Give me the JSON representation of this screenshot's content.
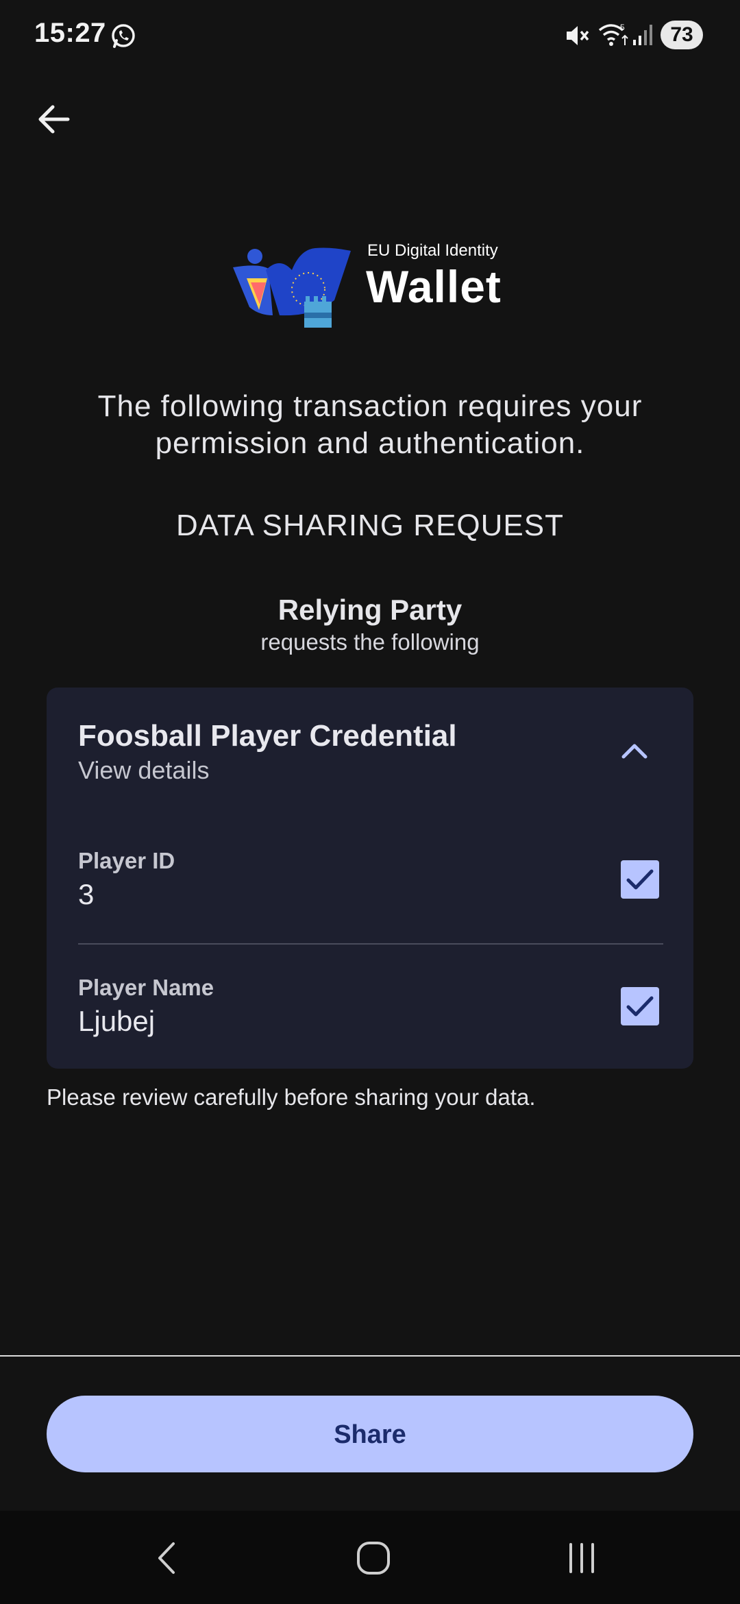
{
  "status_bar": {
    "time": "15:27",
    "battery": "73",
    "icons": [
      "whatsapp-icon",
      "mute-icon",
      "wifi-icon",
      "signal-icon",
      "battery-icon"
    ]
  },
  "header": {
    "back_icon": "arrow-left-icon"
  },
  "logo": {
    "eyebrow": "EU Digital Identity",
    "title": "Wallet"
  },
  "intro_text": "The following transaction requires your permission and authentication.",
  "section_title": "DATA SHARING REQUEST",
  "relying_party": {
    "name": "Relying Party",
    "subtitle": "requests the following"
  },
  "credential": {
    "title": "Foosball Player Credential",
    "subtitle": "View details",
    "expanded": true,
    "fields": [
      {
        "label": "Player ID",
        "value": "3",
        "checked": true
      },
      {
        "label": "Player Name",
        "value": "Ljubej",
        "checked": true
      }
    ]
  },
  "review_note": "Please review carefully before sharing your data.",
  "share_button_label": "Share",
  "colors": {
    "background": "#131313",
    "card": "#1d1f2f",
    "accent": "#b7c4ff",
    "accent_text": "#1b2b6b"
  },
  "nav_bar": {
    "icons": [
      "back-icon",
      "home-icon",
      "recents-icon"
    ]
  }
}
